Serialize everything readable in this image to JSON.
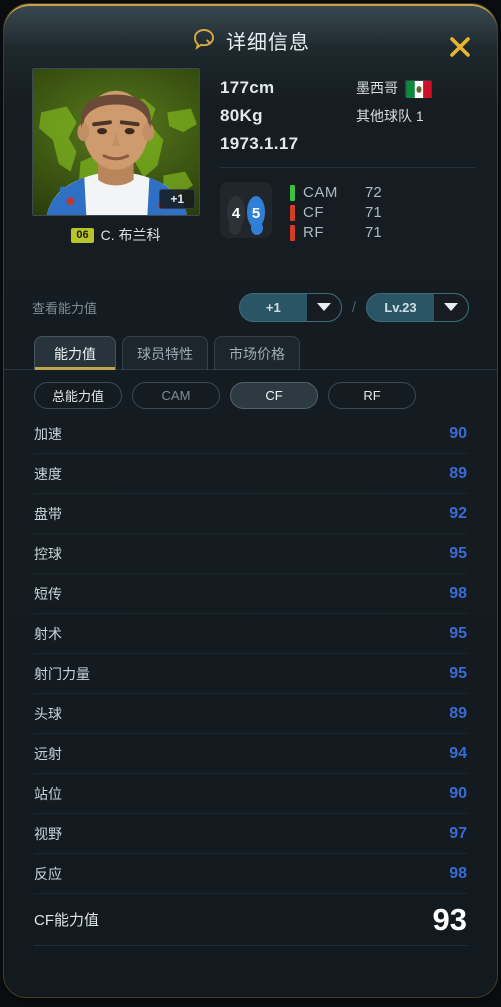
{
  "header": {
    "title": "详细信息",
    "icon": "search-bubble-icon",
    "close_icon": "close-icon",
    "accent_color": "#d8a93f"
  },
  "player": {
    "photo_badge": "+1",
    "position_badge": "06",
    "name": "C. 布兰科",
    "height": "177cm",
    "weight": "80Kg",
    "birthdate": "1973.1.17",
    "nationality": "墨西哥",
    "nationality_flag": "mexico-flag-icon",
    "club": "其他球队 1",
    "weak_foot": "4",
    "skill_moves": "5",
    "positions": [
      {
        "name": "CAM",
        "value": "72",
        "color": "#3fbf3f"
      },
      {
        "name": "CF",
        "value": "71",
        "color": "#d43c2a"
      },
      {
        "name": "RF",
        "value": "71",
        "color": "#d43c2a"
      }
    ]
  },
  "view_rating": {
    "label": "查看能力值",
    "separator": "/",
    "training": {
      "value": "+1",
      "icon": "chevron-down-icon"
    },
    "level": {
      "value": "Lv.23",
      "icon": "chevron-down-icon"
    }
  },
  "tabs": [
    {
      "label": "能力值",
      "active": true
    },
    {
      "label": "球员特性",
      "active": false
    },
    {
      "label": "市场价格",
      "active": false
    }
  ],
  "subtabs": [
    {
      "label": "总能力值",
      "state": "normal"
    },
    {
      "label": "CAM",
      "state": "dim"
    },
    {
      "label": "CF",
      "state": "selected"
    },
    {
      "label": "RF",
      "state": "normal"
    }
  ],
  "stats": [
    {
      "name": "加速",
      "value": "90"
    },
    {
      "name": "速度",
      "value": "89"
    },
    {
      "name": "盘带",
      "value": "92"
    },
    {
      "name": "控球",
      "value": "95"
    },
    {
      "name": "短传",
      "value": "98"
    },
    {
      "name": "射术",
      "value": "95"
    },
    {
      "name": "射门力量",
      "value": "95"
    },
    {
      "name": "头球",
      "value": "89"
    },
    {
      "name": "远射",
      "value": "94"
    },
    {
      "name": "站位",
      "value": "90"
    },
    {
      "name": "视野",
      "value": "97"
    },
    {
      "name": "反应",
      "value": "98"
    }
  ],
  "total": {
    "label": "CF能力值",
    "value": "93"
  },
  "colors": {
    "stat_value": "#3a6bd4",
    "gold": "#c9a44b",
    "pill": "#2a5564"
  }
}
